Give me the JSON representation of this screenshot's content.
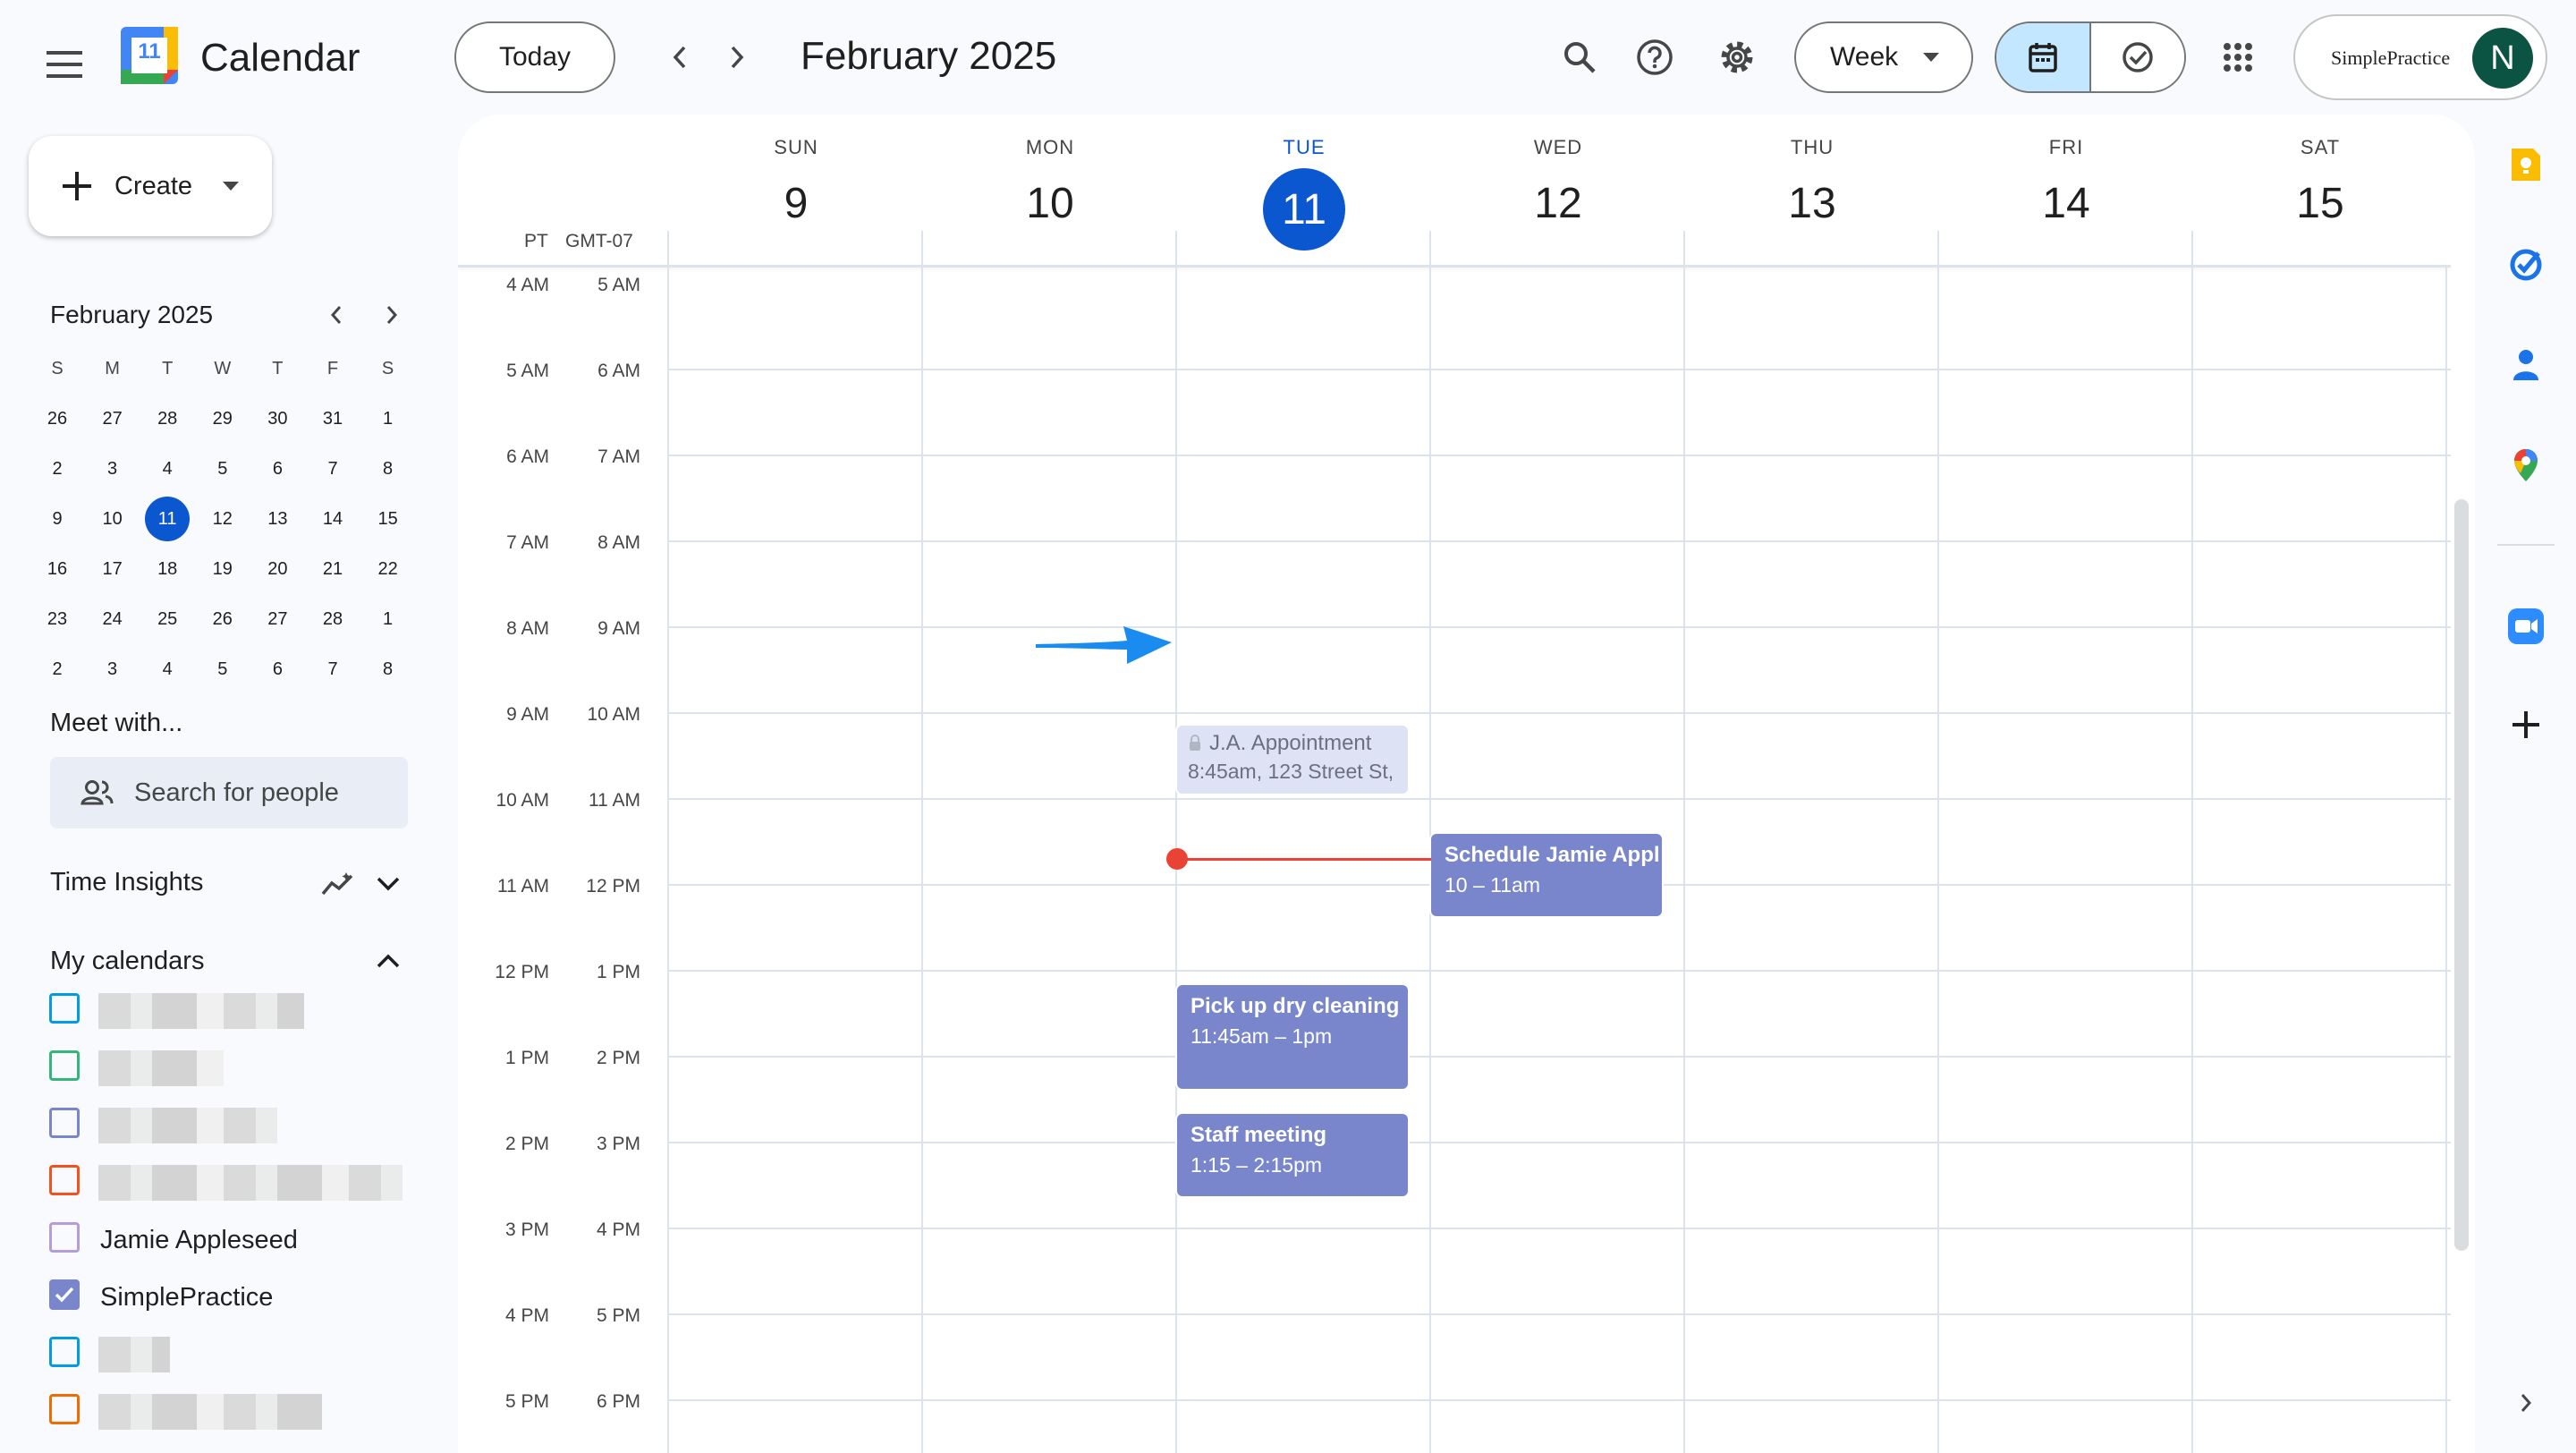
{
  "header": {
    "app_title": "Calendar",
    "logo_day": "11",
    "today_label": "Today",
    "current_period": "February 2025",
    "view_label": "Week",
    "account_brand": "SimplePractice",
    "avatar_initial": "N"
  },
  "sidebar": {
    "create_label": "Create",
    "mini_calendar": {
      "month_label": "February 2025",
      "weekday_headers": [
        "S",
        "M",
        "T",
        "W",
        "T",
        "F",
        "S"
      ],
      "weeks": [
        [
          "26",
          "27",
          "28",
          "29",
          "30",
          "31",
          "1"
        ],
        [
          "2",
          "3",
          "4",
          "5",
          "6",
          "7",
          "8"
        ],
        [
          "9",
          "10",
          "11",
          "12",
          "13",
          "14",
          "15"
        ],
        [
          "16",
          "17",
          "18",
          "19",
          "20",
          "21",
          "22"
        ],
        [
          "23",
          "24",
          "25",
          "26",
          "27",
          "28",
          "1"
        ],
        [
          "2",
          "3",
          "4",
          "5",
          "6",
          "7",
          "8"
        ]
      ],
      "selected_day": "11"
    },
    "meet_with_label": "Meet with...",
    "search_people_placeholder": "Search for people",
    "time_insights_label": "Time Insights",
    "my_calendars_label": "My calendars",
    "calendars": [
      {
        "name": "",
        "color": "#039be5",
        "checked": false,
        "redacted": true
      },
      {
        "name": "",
        "color": "#33b679",
        "checked": false,
        "redacted": true
      },
      {
        "name": "",
        "color": "#7986cb",
        "checked": false,
        "redacted": true
      },
      {
        "name": "",
        "color": "#f4511e",
        "checked": false,
        "redacted": true
      },
      {
        "name": "Jamie Appleseed",
        "color": "#b39ddb",
        "checked": false,
        "redacted": false
      },
      {
        "name": "SimplePractice",
        "color": "#7986cb",
        "checked": true,
        "redacted": false
      },
      {
        "name": "",
        "color": "#039be5",
        "checked": false,
        "redacted": true
      },
      {
        "name": "",
        "color": "#ef6c00",
        "checked": false,
        "redacted": true
      }
    ]
  },
  "week": {
    "timezones": [
      "PT",
      "GMT-07"
    ],
    "days": [
      {
        "name": "SUN",
        "num": "9"
      },
      {
        "name": "MON",
        "num": "10"
      },
      {
        "name": "TUE",
        "num": "11",
        "today": true
      },
      {
        "name": "WED",
        "num": "12"
      },
      {
        "name": "THU",
        "num": "13"
      },
      {
        "name": "FRI",
        "num": "14"
      },
      {
        "name": "SAT",
        "num": "15"
      }
    ],
    "time_rows": [
      {
        "pt": "4 AM",
        "gmt": "5 AM"
      },
      {
        "pt": "5 AM",
        "gmt": "6 AM"
      },
      {
        "pt": "6 AM",
        "gmt": "7 AM"
      },
      {
        "pt": "7 AM",
        "gmt": "8 AM"
      },
      {
        "pt": "8 AM",
        "gmt": "9 AM"
      },
      {
        "pt": "9 AM",
        "gmt": "10 AM"
      },
      {
        "pt": "10 AM",
        "gmt": "11 AM"
      },
      {
        "pt": "11 AM",
        "gmt": "12 PM"
      },
      {
        "pt": "12 PM",
        "gmt": "1 PM"
      },
      {
        "pt": "1 PM",
        "gmt": "2 PM"
      },
      {
        "pt": "2 PM",
        "gmt": "3 PM"
      },
      {
        "pt": "3 PM",
        "gmt": "4 PM"
      },
      {
        "pt": "4 PM",
        "gmt": "5 PM"
      },
      {
        "pt": "5 PM",
        "gmt": "6 PM"
      }
    ],
    "events": {
      "ja_appointment": {
        "title": "J.A. Appointment",
        "detail": "8:45am, 123 Street St,"
      },
      "schedule_jamie": {
        "title": "Schedule Jamie Appl",
        "detail": "10 – 11am"
      },
      "dry_cleaning": {
        "title": "Pick up dry cleaning",
        "detail": "11:45am – 1pm"
      },
      "staff_meeting": {
        "title": "Staff meeting",
        "detail": "1:15 – 2:15pm"
      }
    }
  },
  "colors": {
    "accent": "#0b57d0",
    "event": "#7986cb",
    "now_line": "#ea4335",
    "annotation_arrow": "#1a8cf0"
  }
}
